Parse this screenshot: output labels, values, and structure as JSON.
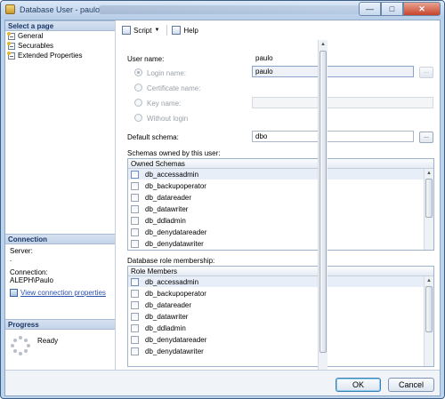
{
  "window": {
    "title": "Database User - paulo"
  },
  "left_pane": {
    "select_page_header": "Select a page",
    "pages": [
      {
        "label": "General",
        "icon": "page-icon"
      },
      {
        "label": "Securables",
        "icon": "page-icon"
      },
      {
        "label": "Extended Properties",
        "icon": "page-icon"
      }
    ],
    "connection_header": "Connection",
    "server_label": "Server:",
    "server_value": ".",
    "connection_label": "Connection:",
    "connection_value": "ALEPH\\Paulo",
    "view_connection_link": "View connection properties",
    "progress_header": "Progress",
    "progress_status": "Ready"
  },
  "toolbar": {
    "script_label": "Script",
    "help_label": "Help"
  },
  "general": {
    "user_name_label": "User name:",
    "user_name_value": "paulo",
    "login_name_label": "Login name:",
    "login_name_value": "paulo",
    "certificate_name_label": "Certificate name:",
    "key_name_label": "Key name:",
    "without_login_label": "Without login",
    "default_schema_label": "Default schema:",
    "default_schema_value": "dbo",
    "browse_label": "...",
    "schemas_owned_label": "Schemas owned by this user:",
    "owned_schemas_header": "Owned Schemas",
    "owned_schemas": [
      "db_accessadmin",
      "db_backupoperator",
      "db_datareader",
      "db_datawriter",
      "db_ddladmin",
      "db_denydatareader",
      "db_denydatawriter"
    ],
    "role_membership_label": "Database role membership:",
    "role_members_header": "Role Members",
    "role_members": [
      "db_accessadmin",
      "db_backupoperator",
      "db_datareader",
      "db_datawriter",
      "db_ddladmin",
      "db_denydatareader",
      "db_denydatawriter"
    ]
  },
  "buttons": {
    "ok": "OK",
    "cancel": "Cancel"
  },
  "colors": {
    "header_text": "#1b3866",
    "link": "#2a4fb0",
    "selection": "#e7eef8"
  }
}
